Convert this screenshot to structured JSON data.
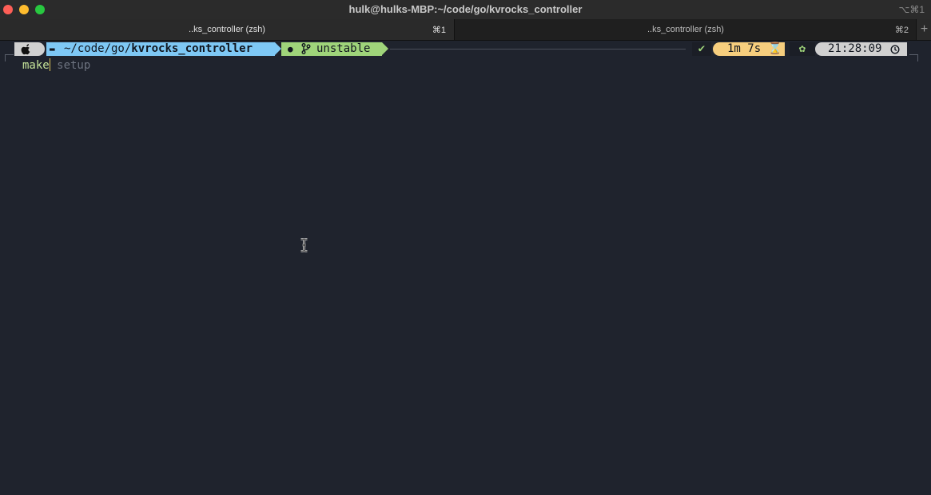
{
  "window": {
    "title": "hulk@hulks-MBP:~/code/go/kvrocks_controller",
    "shortcut": "⌥⌘1"
  },
  "tabs": [
    {
      "label": "..ks_controller (zsh)",
      "shortcut": "⌘1"
    },
    {
      "label": "..ks_controller (zsh)",
      "shortcut": "⌘2"
    }
  ],
  "tab_add": "+",
  "prompt": {
    "dir_prefix": "~/code/go/",
    "dir_name": "kvrocks_controller",
    "branch": "unstable",
    "status_mark": "✔",
    "duration": "1m 7s",
    "time": "21:28:09"
  },
  "command": {
    "typed": "make",
    "suggestion": " setup"
  },
  "colors": {
    "background": "#1f232d",
    "dir_segment": "#7ec8f5",
    "git_segment": "#9fd47a",
    "duration_segment": "#f6ce7e",
    "clock_segment": "#d0d0d0"
  },
  "icons": [
    "apple-icon",
    "folder-icon",
    "github-icon",
    "git-branch-icon",
    "check-icon",
    "hourglass-icon",
    "gear-icon",
    "clock-icon",
    "text-cursor-icon"
  ]
}
